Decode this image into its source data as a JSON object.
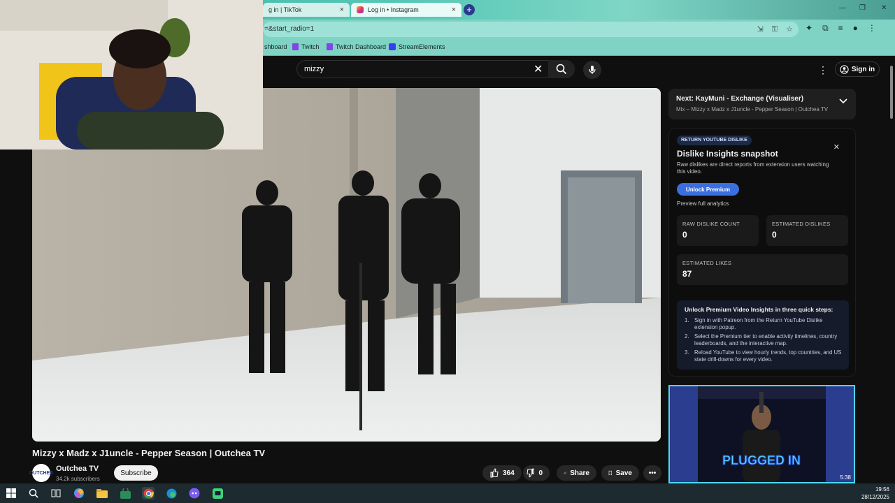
{
  "browser": {
    "tabs": [
      {
        "label": "g in | TikTok"
      },
      {
        "label": "Log in • Instagram"
      }
    ],
    "url": "=&start_radio=1",
    "bookmarks": [
      {
        "label": "shboard"
      },
      {
        "label": "Twitch"
      },
      {
        "label": "Twitch Dashboard"
      },
      {
        "label": "StreamElements"
      }
    ]
  },
  "header": {
    "search_value": "mizzy",
    "signin_label": "Sign in"
  },
  "video": {
    "title": "Mizzy x Madz x J1uncle - Pepper Season | Outchea TV",
    "channel_name": "Outchea TV",
    "channel_subs": "34.2k subscribers",
    "channel_avatar_text": "OUTCHEA",
    "subscribe_label": "Subscribe",
    "likes": "364",
    "dislikes": "0",
    "share_label": "Share",
    "save_label": "Save"
  },
  "next_up": {
    "title": "Next: KayMuni - Exchange (Visualiser)",
    "subtitle": "Mix – Mizzy x Madz x J1uncle - Pepper Season | Outchea TV"
  },
  "ryd_panel": {
    "badge": "RETURN YOUTUBE DISLIKE",
    "title": "Dislike Insights snapshot",
    "description": "Raw dislikes are direct reports from extension users watching this video.",
    "unlock_label": "Unlock Premium",
    "preview_label": "Preview full analytics",
    "stats": [
      {
        "label": "RAW DISLIKE COUNT",
        "value": "0"
      },
      {
        "label": "ESTIMATED DISLIKES",
        "value": "0"
      },
      {
        "label": "ESTIMATED LIKES",
        "value": "87"
      }
    ],
    "steps_title": "Unlock Premium Video Insights in three quick steps:",
    "steps": [
      "Sign in with Patreon from the Return YouTube Dislike extension popup.",
      "Select the Premium tier to enable activity timelines, country leaderboards, and the interactive map.",
      "Reload YouTube to view hourly trends, top countries, and US state drill-downs for every video."
    ]
  },
  "recommended": {
    "duration": "5:38",
    "overlay_text": "PLUGGED IN"
  },
  "taskbar": {
    "time": "19:56",
    "date": "28/12/2025"
  },
  "colors": {
    "browser_theme": "#7fd3c5",
    "youtube_bg": "#0f0f0f",
    "premium_blue": "#3b6fe0",
    "thumb_border": "#4ad8f0"
  }
}
